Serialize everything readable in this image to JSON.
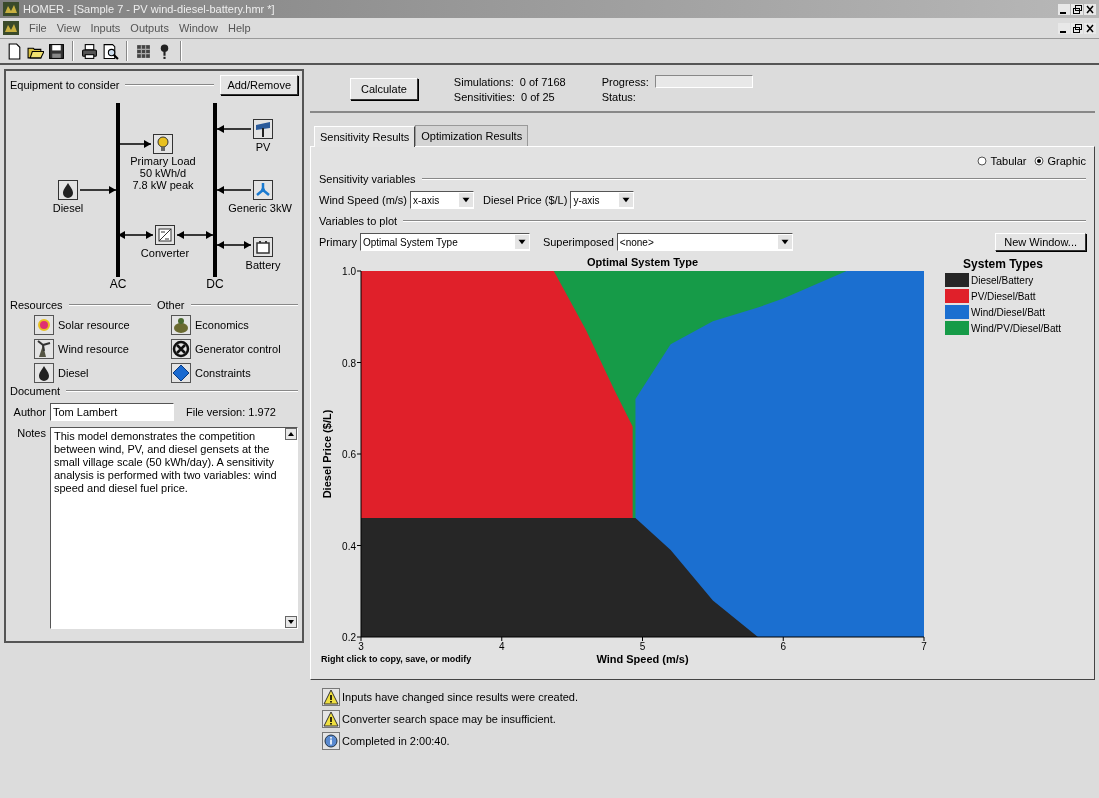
{
  "window": {
    "title": "HOMER - [Sample 7 - PV wind-diesel-battery.hmr *]"
  },
  "menu": [
    "File",
    "View",
    "Inputs",
    "Outputs",
    "Window",
    "Help"
  ],
  "equipment": {
    "heading": "Equipment to consider",
    "add_button": "Add/Remove",
    "buses": [
      "AC",
      "DC"
    ],
    "components": [
      {
        "kind": "load",
        "label": [
          "Primary Load",
          "50 kWh/d",
          "7.8 kW peak"
        ]
      },
      {
        "kind": "diesel",
        "label": [
          "Diesel"
        ]
      },
      {
        "kind": "converter",
        "label": [
          "Converter"
        ]
      },
      {
        "kind": "pv",
        "label": [
          "PV"
        ]
      },
      {
        "kind": "wind",
        "label": [
          "Generic 3kW"
        ]
      },
      {
        "kind": "battery",
        "label": [
          "Battery"
        ]
      }
    ]
  },
  "resources": {
    "heading": "Resources",
    "items": [
      {
        "kind": "solar",
        "label": "Solar resource"
      },
      {
        "kind": "wind",
        "label": "Wind resource"
      },
      {
        "kind": "diesel",
        "label": "Diesel"
      }
    ]
  },
  "other": {
    "heading": "Other",
    "items": [
      {
        "kind": "economics",
        "label": "Economics"
      },
      {
        "kind": "generator",
        "label": "Generator control"
      },
      {
        "kind": "constraints",
        "label": "Constraints"
      }
    ]
  },
  "document": {
    "heading": "Document",
    "author_label": "Author",
    "author": "Tom Lambert",
    "file_version": "File version: 1.972",
    "notes_label": "Notes",
    "notes": "This model demonstrates the competition between wind, PV, and diesel gensets at the small village scale (50 kWh/day).  A sensitivity analysis is performed with two variables: wind speed and diesel fuel price."
  },
  "run": {
    "calculate": "Calculate",
    "stats": [
      {
        "label": "Simulations:",
        "value": "0 of 7168"
      },
      {
        "label": "Sensitivities:",
        "value": "0 of 25"
      }
    ],
    "progress_label": "Progress:",
    "level": 0,
    "status_label": "Status:"
  },
  "tabs": [
    {
      "label": "Sensitivity Results",
      "selected": true
    },
    {
      "label": "Optimization Results",
      "selected": false
    }
  ],
  "view_modes": [
    {
      "label": "Tabular",
      "selected": false
    },
    {
      "label": "Graphic",
      "selected": true
    }
  ],
  "sensitivity": {
    "heading": "Sensitivity variables",
    "variables": [
      {
        "label": "Wind Speed (m/s)",
        "value": "x-axis"
      },
      {
        "label": "Diesel Price ($/L)",
        "value": "y-axis"
      }
    ]
  },
  "plot_vars": {
    "heading": "Variables to plot",
    "primary_label": "Primary",
    "primary": "Optimal System Type",
    "superimposed_label": "Superimposed",
    "superimposed": "<none>",
    "new_window": "New Window..."
  },
  "chart": {
    "legend_title": "System Types",
    "note": "Right click to copy, save, or modify",
    "chart_data": {
      "type": "area",
      "stacked": false,
      "title": "Optimal System Type",
      "xlabel": "Wind Speed (m/s)",
      "ylabel": "Diesel Price ($/L)",
      "x": [
        3,
        3.5,
        4,
        4.37,
        4.6,
        4.8,
        4.93,
        4.95,
        5.2,
        5.5,
        5.82,
        6,
        6.45,
        7
      ],
      "xlim": [
        3,
        7
      ],
      "ylim": [
        0.2,
        1
      ],
      "xticks": [
        3,
        4,
        5,
        6,
        7
      ],
      "yticks": [
        0.2,
        0.4,
        0.6,
        0.8,
        {
          "value": 1,
          "label": "1.0"
        }
      ],
      "series": [
        {
          "name": "Diesel/Battery",
          "color": "#262626",
          "values": [
            0.46,
            0.46,
            0.46,
            0.46,
            0.46,
            0.46,
            0.46,
            0.46,
            0.39,
            0.28,
            0.2,
            null,
            null,
            null
          ]
        },
        {
          "name": "PV/Diesel/Batt",
          "color": "#e0202a",
          "values": [
            1,
            1,
            1,
            1,
            0.87,
            0.74,
            0.66,
            null,
            null,
            null,
            null,
            null,
            null,
            null
          ]
        },
        {
          "name": "Wind/Diesel/Batt",
          "color": "#1b6fd0",
          "values": [
            null,
            null,
            null,
            null,
            null,
            null,
            null,
            0.72,
            0.84,
            0.89,
            0.92,
            0.94,
            1,
            1
          ]
        },
        {
          "name": "Wind/PV/Diesel/Batt",
          "color": "#169b48",
          "values": [
            null,
            null,
            null,
            1,
            1,
            1,
            1,
            1,
            1,
            1,
            1,
            1,
            1,
            null
          ]
        }
      ]
    }
  },
  "messages": [
    {
      "kind": "warning",
      "text": "Inputs have changed since results were created."
    },
    {
      "kind": "warning",
      "text": "Converter search space may be insufficient."
    },
    {
      "kind": "info",
      "text": "Completed in 2:00:40."
    }
  ]
}
